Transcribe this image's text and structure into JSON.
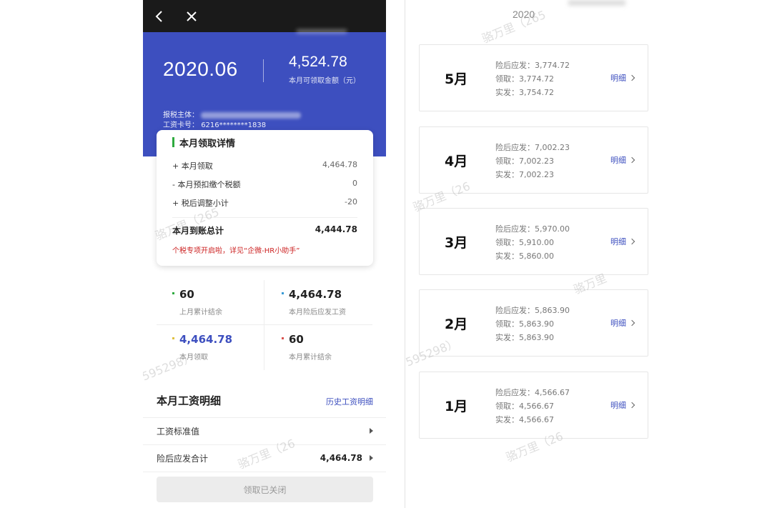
{
  "left": {
    "hero": {
      "month": "2020.06",
      "amount": "4,524.78",
      "amount_label": "本月可领取金额（元）",
      "tax_label": "报税主体：",
      "card_label": "工资卡号：",
      "card_number": "6216********1838"
    },
    "detail": {
      "title": "本月领取详情",
      "rows": [
        {
          "label": "+ 本月领取",
          "value": "4,464.78"
        },
        {
          "label": "- 本月预扣缴个税额",
          "value": "0"
        },
        {
          "label": "+ 税后调整小计",
          "value": "-20"
        }
      ],
      "total_label": "本月到账总计",
      "total_value": "4,444.78",
      "notice": "个税专项开启啦，详见“企微-HR小助手”"
    },
    "stats": [
      {
        "value": "60",
        "label": "上月累计结余",
        "color": "#2eaa3f"
      },
      {
        "value": "4,464.78",
        "label": "本月险后应发工资",
        "color": "#3a9bd6"
      },
      {
        "value": "4,464.78",
        "label": "本月领取",
        "color": "#e0c040"
      },
      {
        "value": "60",
        "label": "本月累计结余",
        "color": "#d9534f"
      }
    ],
    "salary": {
      "title": "本月工资明细",
      "history_link": "历史工资明细",
      "rows": [
        {
          "label": "工资标准值",
          "amount": ""
        },
        {
          "label": "险后应发合计",
          "amount": "4,464.78"
        }
      ],
      "closed_button": "领取已关闭"
    }
  },
  "right": {
    "year": "2020",
    "months": [
      {
        "name": "5月",
        "line1": "险后应发：3,774.72",
        "line2": "领取：3,774.72",
        "line3": "实发：3,754.72",
        "more": "明细"
      },
      {
        "name": "4月",
        "line1": "险后应发：7,002.23",
        "line2": "领取：7,002.23",
        "line3": "实发：7,002.23",
        "more": "明细"
      },
      {
        "name": "3月",
        "line1": "险后应发：5,970.00",
        "line2": "领取：5,910.00",
        "line3": "实发：5,860.00",
        "more": "明细"
      },
      {
        "name": "2月",
        "line1": "险后应发：5,863.90",
        "line2": "领取：5,863.90",
        "line3": "实发：5,863.90",
        "more": "明细"
      },
      {
        "name": "1月",
        "line1": "险后应发：4,566.67",
        "line2": "领取：4,566.67",
        "line3": "实发：4,566.67",
        "more": "明细"
      }
    ]
  },
  "watermark": {
    "name": "骆万里",
    "code_a": "（265",
    "code_b": "595298）",
    "code_c": "（26"
  },
  "colors": {
    "brand_blue": "#3d4fbf",
    "notice_red": "#cc2222",
    "topbar": "#1a1a1a"
  }
}
